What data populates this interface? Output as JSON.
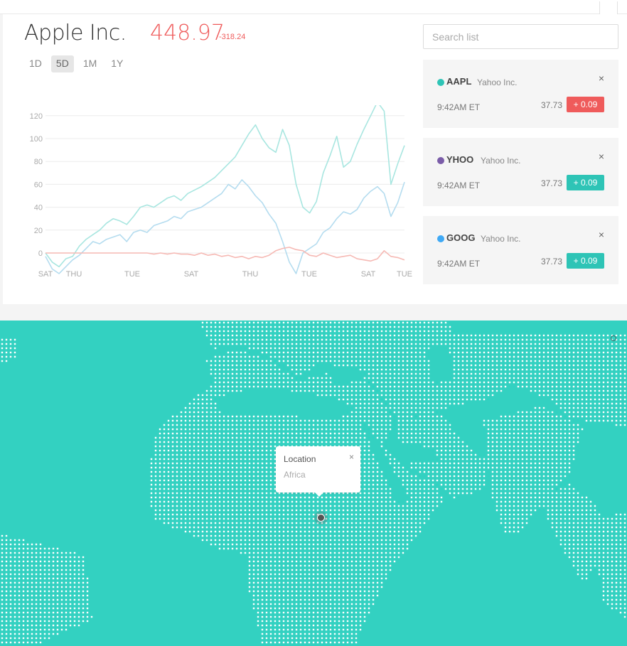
{
  "header": {
    "company": "Apple Inc.",
    "price": "448.97",
    "change": "-318.24",
    "ranges": [
      "1D",
      "5D",
      "1M",
      "1Y"
    ],
    "active_range": "5D"
  },
  "colors": {
    "accent_red": "#ef5b5b",
    "teal": "#33d1c1",
    "purple": "#7a5ca8",
    "blue": "#3fa9f5"
  },
  "search": {
    "placeholder": "Search list"
  },
  "watchlist": [
    {
      "symbol": "AAPL",
      "name": "Yahoo Inc.",
      "time": "9:42AM ET",
      "value": "37.73",
      "change": "+ 0.09",
      "dot_color": "#2ec4b6",
      "badge_color": "#ef5b5b"
    },
    {
      "symbol": "YHOO",
      "name": "Yahoo Inc.",
      "time": "9:42AM ET",
      "value": "37.73",
      "change": "+ 0.09",
      "dot_color": "#7a5ca8",
      "badge_color": "#2ec4b6"
    },
    {
      "symbol": "GOOG",
      "name": "Yahoo Inc.",
      "time": "9:42AM ET",
      "value": "37.73",
      "change": "+ 0.09",
      "dot_color": "#3fa9f5",
      "badge_color": "#2ec4b6"
    }
  ],
  "chart_data": {
    "type": "line",
    "x_labels": [
      "SAT",
      "THU",
      "TUE",
      "SAT",
      "THU",
      "TUE",
      "SAT",
      "TUE"
    ],
    "y_ticks": [
      0,
      20,
      40,
      60,
      80,
      100,
      120
    ],
    "ylim": [
      -20,
      130
    ],
    "grid": true,
    "series": [
      {
        "color": "#a8e6e0",
        "values": [
          0,
          -8,
          -12,
          -5,
          -3,
          6,
          12,
          16,
          20,
          26,
          30,
          28,
          25,
          32,
          40,
          42,
          40,
          44,
          48,
          50,
          46,
          52,
          55,
          58,
          62,
          66,
          72,
          78,
          84,
          94,
          104,
          112,
          100,
          92,
          88,
          108,
          94,
          60,
          40,
          35,
          45,
          70,
          85,
          102,
          75,
          80,
          95,
          108,
          120,
          132,
          124,
          60,
          78,
          94
        ]
      },
      {
        "color": "#b4dcef",
        "values": [
          -3,
          -14,
          -18,
          -12,
          -6,
          -2,
          4,
          10,
          8,
          12,
          14,
          16,
          10,
          18,
          20,
          18,
          24,
          26,
          28,
          32,
          30,
          36,
          38,
          40,
          44,
          48,
          52,
          60,
          56,
          64,
          58,
          50,
          44,
          34,
          26,
          10,
          -8,
          -18,
          0,
          4,
          8,
          18,
          22,
          30,
          36,
          34,
          38,
          48,
          54,
          58,
          52,
          32,
          44,
          62
        ]
      },
      {
        "color": "#f6b9b4",
        "values": [
          0,
          0,
          0,
          0,
          0,
          0,
          0,
          0,
          0,
          0,
          0,
          0,
          0,
          0,
          0,
          0,
          -1,
          0,
          -1,
          0,
          -1,
          -1,
          -2,
          0,
          -2,
          -1,
          -3,
          -2,
          -4,
          -3,
          -5,
          -3,
          -4,
          -2,
          2,
          4,
          5,
          3,
          2,
          -2,
          -3,
          0,
          -2,
          -4,
          -3,
          -2,
          -5,
          -6,
          -7,
          -5,
          2,
          -3,
          -4,
          -6
        ]
      }
    ]
  },
  "map": {
    "popup_title": "Location",
    "popup_value": "Africa",
    "popup_close": "×",
    "land_color": "#ffffff",
    "water_color": "#33d1c1"
  }
}
